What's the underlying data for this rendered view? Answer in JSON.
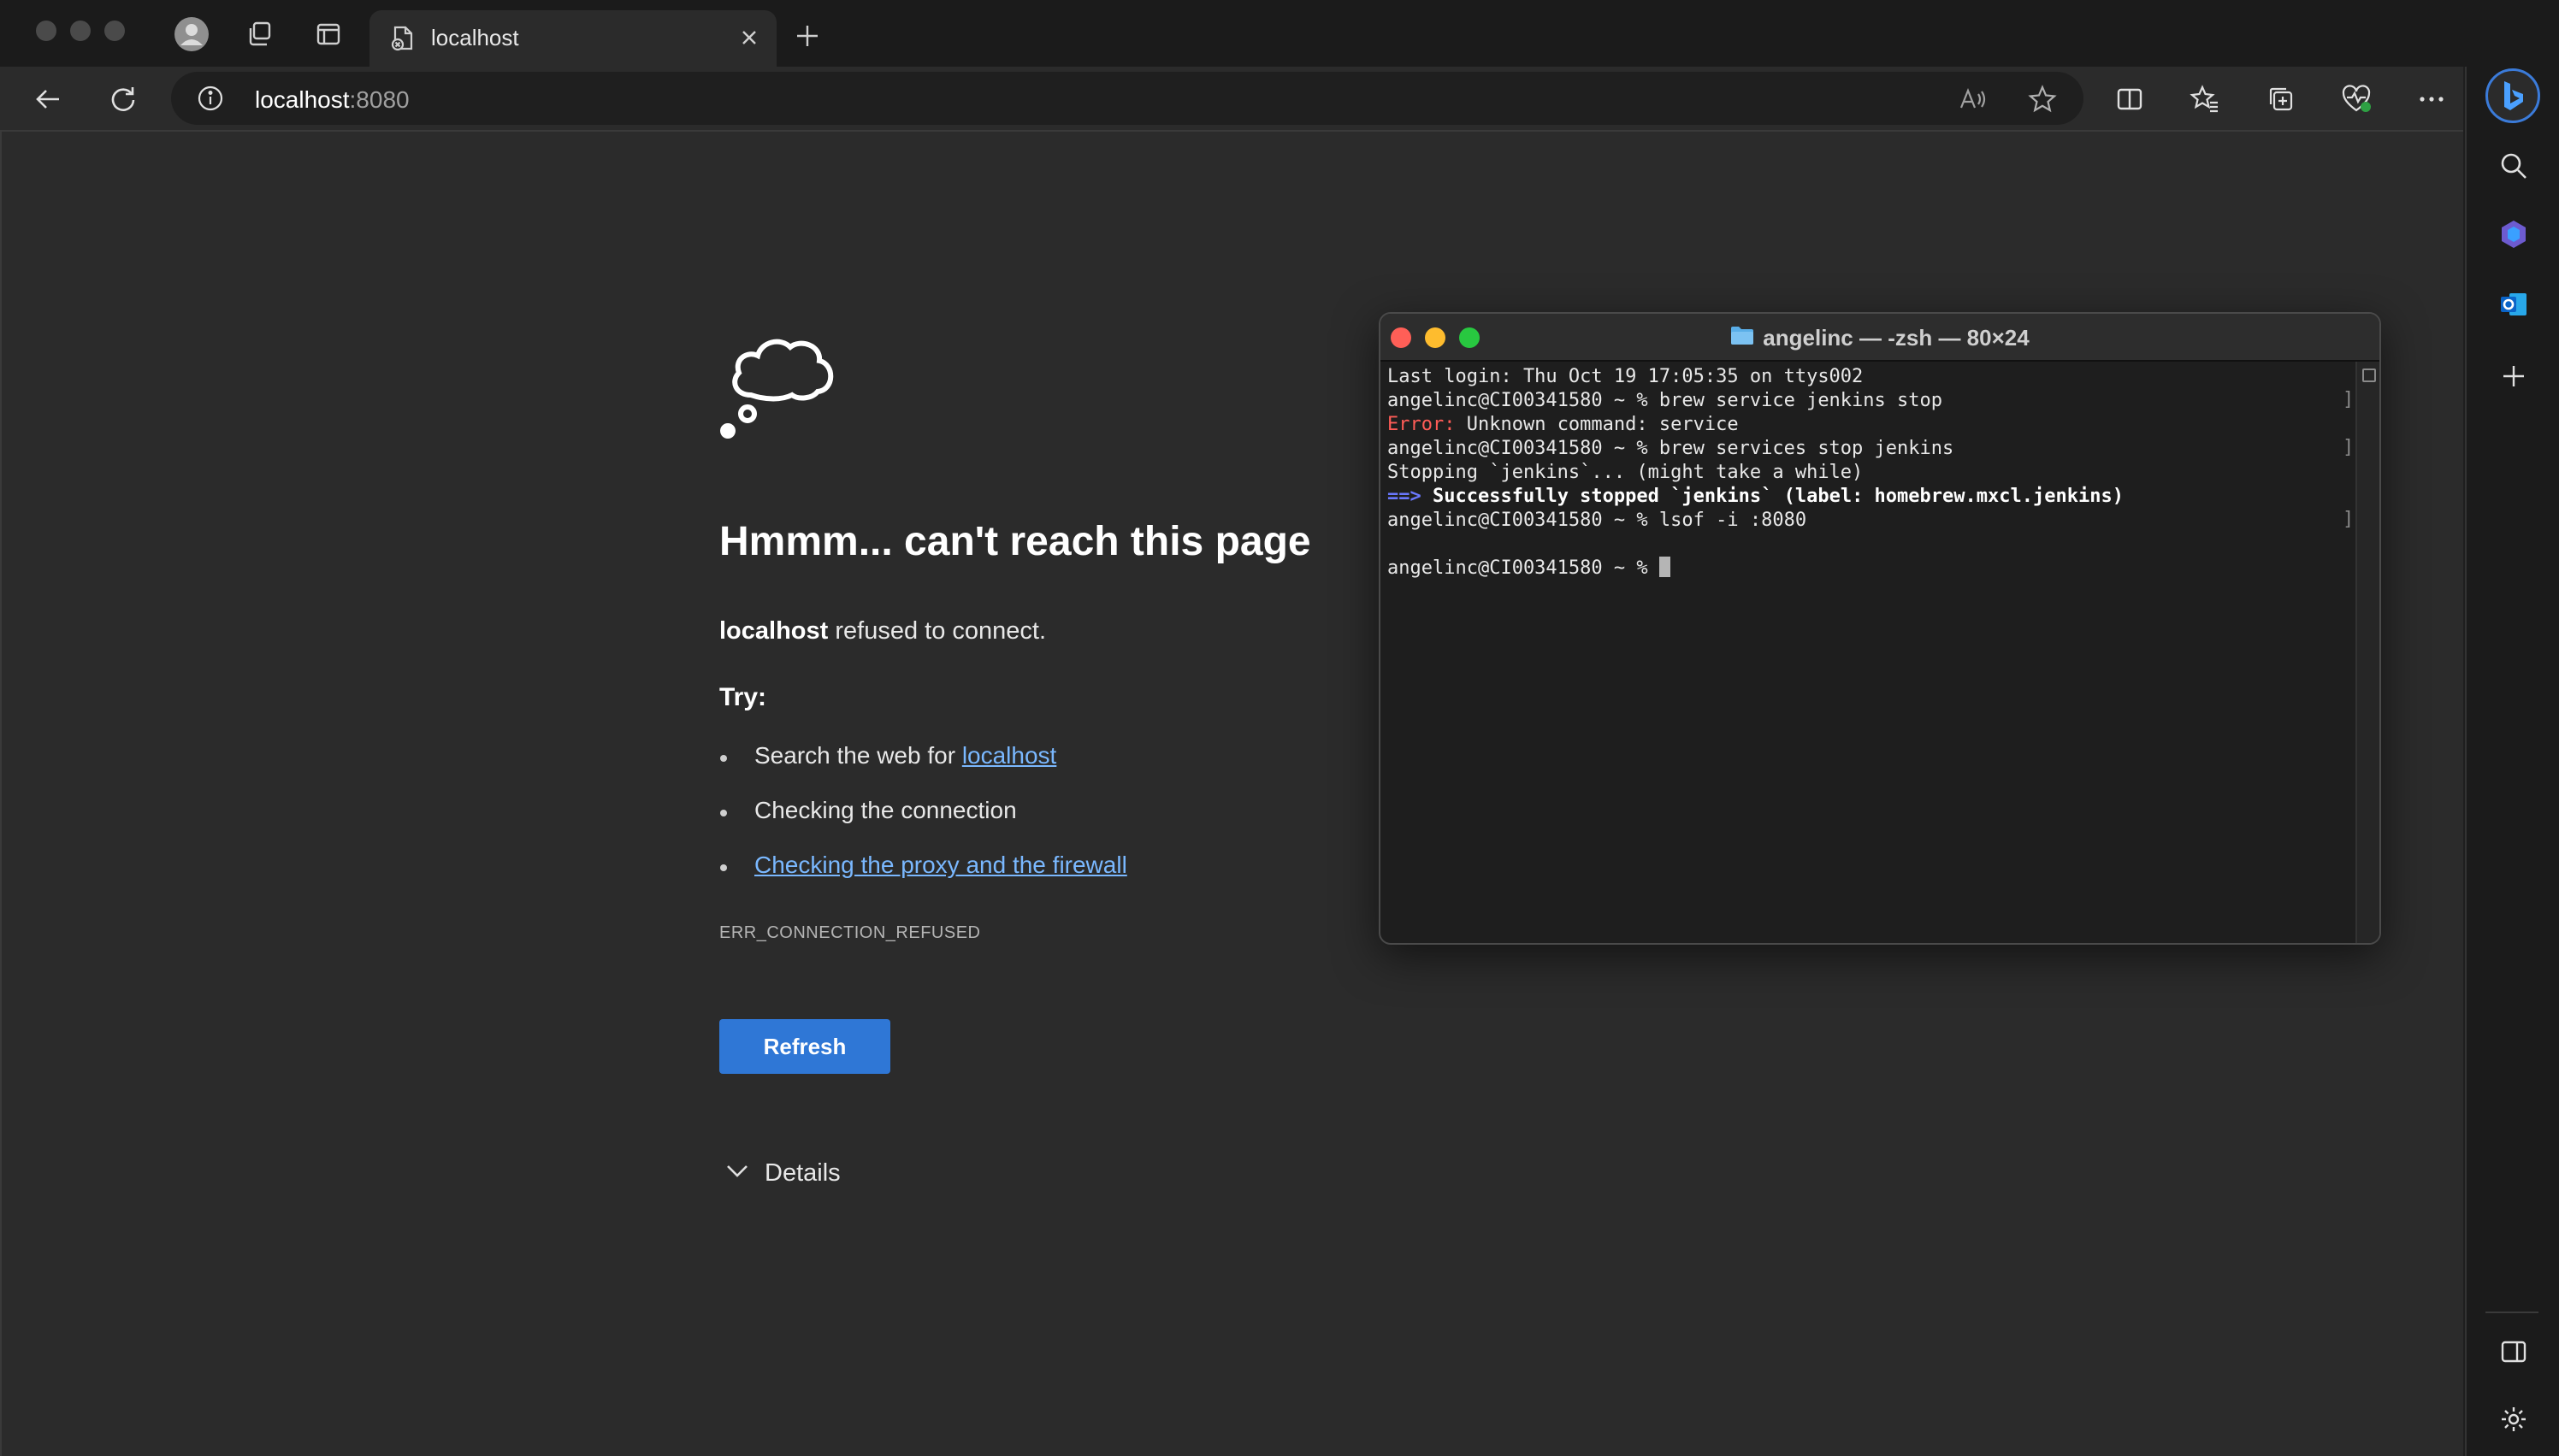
{
  "browser": {
    "tab": {
      "title": "localhost"
    },
    "address": {
      "host": "localhost",
      "port": ":8080"
    }
  },
  "page": {
    "title": "Hmmm... can't reach this page",
    "desc_bold": "localhost",
    "desc_rest": " refused to connect.",
    "try_label": "Try:",
    "suggestions": [
      {
        "prefix": "Search the web for ",
        "link": "localhost"
      },
      {
        "text": "Checking the connection"
      },
      {
        "link": "Checking the proxy and the firewall"
      }
    ],
    "error_code": "ERR_CONNECTION_REFUSED",
    "refresh_label": "Refresh",
    "details_label": "Details"
  },
  "terminal": {
    "title": "angelinc — -zsh — 80×24",
    "lines": {
      "l1": "Last login: Thu Oct 19 17:05:35 on ttys002",
      "l2": "angelinc@CI00341580 ~ % brew service jenkins stop",
      "l3_prefix": "Error:",
      "l3_rest": " Unknown command: service",
      "l4": "angelinc@CI00341580 ~ % brew services stop jenkins",
      "l5": "Stopping `jenkins`... (might take a while)",
      "l6_prefix": "==>",
      "l6_rest": " Successfully stopped `jenkins` (label: homebrew.mxcl.jenkins)",
      "l7": "angelinc@CI00341580 ~ % lsof -i :8080",
      "l8": "angelinc@CI00341580 ~ % "
    }
  },
  "colors": {
    "accent": "#2f77d6",
    "link": "#7ab8ff",
    "terminal_error": "#ff5c57",
    "terminal_arrow": "#6a78ff"
  }
}
